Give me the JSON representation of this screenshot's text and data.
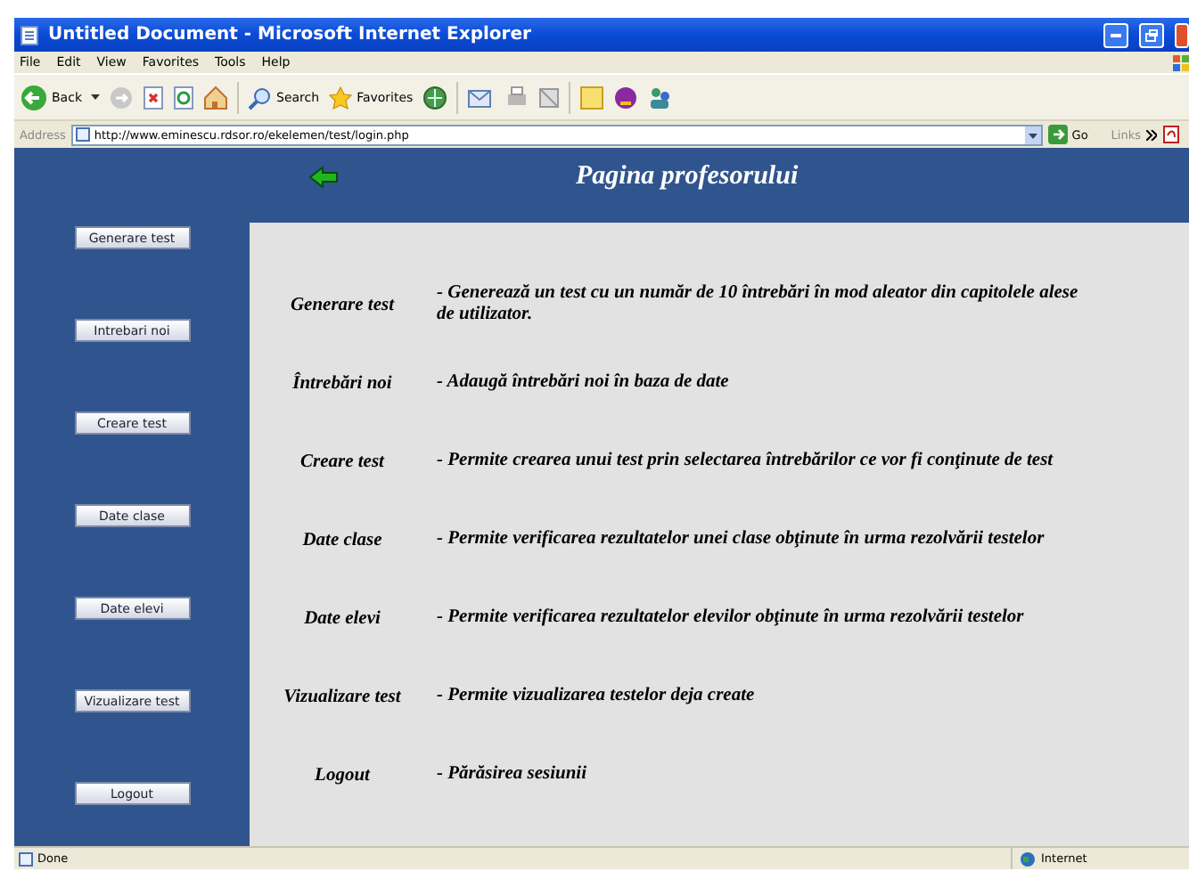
{
  "window": {
    "title": "Untitled Document - Microsoft Internet Explorer"
  },
  "menu": [
    "File",
    "Edit",
    "View",
    "Favorites",
    "Tools",
    "Help"
  ],
  "toolbar": {
    "back": "Back",
    "search": "Search",
    "favorites": "Favorites"
  },
  "address_bar": {
    "label": "Address",
    "url": "http://www.eminescu.rdsor.ro/ekelemen/test/login.php",
    "go": "Go",
    "links": "Links"
  },
  "page": {
    "title": "Pagina profesorului",
    "nav_buttons": [
      "Generare test",
      "Intrebari noi",
      "Creare test",
      "Date clase",
      "Date elevi",
      "Vizualizare test",
      "Logout"
    ],
    "descriptions": [
      {
        "term": "Generare test",
        "text": "- Generează un test cu un număr de 10 întrebări în mod aleator din capitolele alese de utilizator."
      },
      {
        "term": "Întrebări noi",
        "text": "- Adaugă întrebări noi în baza de date"
      },
      {
        "term": "Creare test",
        "text": "- Permite crearea unui test prin selectarea întrebărilor ce vor fi conţinute de test"
      },
      {
        "term": "Date clase",
        "text": "- Permite verificarea rezultatelor unei clase obţinute în urma rezolvării testelor"
      },
      {
        "term": "Date elevi",
        "text": "- Permite verificarea rezultatelor elevilor obţinute în urma rezolvării testelor"
      },
      {
        "term": "Vizualizare test",
        "text": "- Permite vizualizarea testelor deja create"
      },
      {
        "term": "Logout",
        "text": "- Părăsirea sesiunii"
      }
    ]
  },
  "status_bar": {
    "status": "Done",
    "zone": "Internet"
  }
}
